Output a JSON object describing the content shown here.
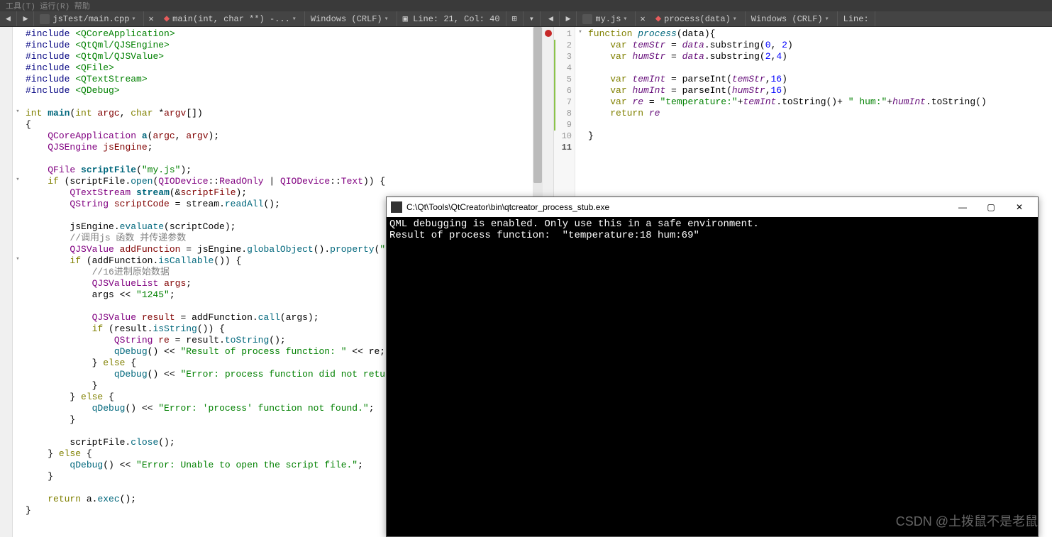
{
  "menu": {
    "text": "工具(T)  运行(R)  帮助"
  },
  "left": {
    "toolbar": {
      "file": "jsTest/main.cpp",
      "symbol": "main(int, char **) -...",
      "encoding": "Windows (CRLF)",
      "position": "Line: 21, Col: 40"
    },
    "code_html": "<span class='pp'>#include</span> <span class='incname'>&lt;QCoreApplication&gt;</span>\n<span class='pp'>#include</span> <span class='incname'>&lt;QtQml/QJSEngine&gt;</span>\n<span class='pp'>#include</span> <span class='incname'>&lt;QtQml/QJSValue&gt;</span>\n<span class='pp'>#include</span> <span class='incname'>&lt;QFile&gt;</span>\n<span class='pp'>#include</span> <span class='incname'>&lt;QTextStream&gt;</span>\n<span class='pp'>#include</span> <span class='incname'>&lt;QDebug&gt;</span>\n\n<span class='kw'>int</span> <span class='fn'>main</span>(<span class='kw'>int</span> <span class='var'>argc</span>, <span class='kw'>char</span> *<span class='var'>argv</span>[])\n{\n    <span class='ty'>QCoreApplication</span> <span class='fn'>a</span>(<span class='var'>argc</span>, <span class='var'>argv</span>);\n    <span class='ty'>QJSEngine</span> <span class='var'>jsEngine</span>;\n\n    <span class='ty'>QFile</span> <span class='fn'>scriptFile</span>(<span class='str'>\"my.js\"</span>);\n    <span class='kw'>if</span> (scriptFile.<span class='fn2'>open</span>(<span class='ty'>QIODevice</span>::<span class='ty'>ReadOnly</span> | <span class='ty'>QIODevice</span>::<span class='ty'>Text</span>)) {\n        <span class='ty'>QTextStream</span> <span class='fn'>stream</span>(&amp;<span class='var'>scriptFile</span>);\n        <span class='ty'>QString</span> <span class='var'>scriptCode</span> = stream.<span class='fn2'>readAll</span>();\n\n        jsEngine.<span class='fn2'>evaluate</span>(scriptCode);\n        <span class='cm'>//调用js 函数 并传递参数</span>\n        <span class='ty'>QJSValue</span> <span class='var'>addFunction</span> = jsEngine.<span class='fn2'>globalObject</span>().<span class='fn2'>property</span>(<span class='str'>\"process\"</span>);\n        <span class='kw'>if</span> (addFunction.<span class='fn2'>isCallable</span>()) {\n            <span class='cm'>//16进制原始数据</span>\n            <span class='ty'>QJSValueList</span> <span class='var'>args</span>;\n            args &lt;&lt; <span class='str'>\"1245\"</span>;\n\n            <span class='ty'>QJSValue</span> <span class='var'>result</span> = addFunction.<span class='fn2'>call</span>(args);\n            <span class='kw'>if</span> (result.<span class='fn2'>isString</span>()) {\n                <span class='ty'>QString</span> <span class='var'>re</span> = result.<span class='fn2'>toString</span>();\n                <span class='fn2'>qDebug</span>() &lt;&lt; <span class='str'>\"Result of process function: \"</span> &lt;&lt; re;\n            } <span class='kw'>else</span> {\n                <span class='fn2'>qDebug</span>() &lt;&lt; <span class='str'>\"Error: process function did not return a valid\"</span>\n            }\n        } <span class='kw'>else</span> {\n            <span class='fn2'>qDebug</span>() &lt;&lt; <span class='str'>\"Error: 'process' function not found.\"</span>;\n        }\n\n        scriptFile.<span class='fn2'>close</span>();\n    } <span class='kw'>else</span> {\n        <span class='fn2'>qDebug</span>() &lt;&lt; <span class='str'>\"Error: Unable to open the script file.\"</span>;\n    }\n\n    <span class='kw'>return</span> a.<span class='fn2'>exec</span>();\n}"
  },
  "right": {
    "toolbar": {
      "file": "my.js",
      "symbol": "process(data)",
      "encoding": "Windows (CRLF)",
      "position": "Line:"
    },
    "line_numbers": [
      "1",
      "2",
      "3",
      "4",
      "5",
      "6",
      "7",
      "8",
      "9",
      "10",
      "11"
    ],
    "code_html": "<span class='js-kw'>function</span> <span class='js-fn'>process</span>(data){\n    <span class='js-kw'>var</span> <span class='js-var'>temStr</span> = <span class='js-var'>data</span>.substring(<span class='js-num'>0</span>, <span class='js-num'>2</span>)\n    <span class='js-kw'>var</span> <span class='js-var'>humStr</span> = <span class='js-var'>data</span>.substring(<span class='js-num'>2</span>,<span class='js-num'>4</span>)\n\n    <span class='js-kw'>var</span> <span class='js-var'>temInt</span> = parseInt(<span class='js-var'>temStr</span>,<span class='js-num'>16</span>)\n    <span class='js-kw'>var</span> <span class='js-var'>humInt</span> = parseInt(<span class='js-var'>humStr</span>,<span class='js-num'>16</span>)\n    <span class='js-kw'>var</span> <span class='js-var'>re</span> = <span class='js-str'>\"temperature:\"</span>+<span class='js-var'>temInt</span>.toString()+ <span class='js-str'>\" hum:\"</span>+<span class='js-var'>humInt</span>.toString()\n    <span class='js-kw'>return</span> <span class='js-var'>re</span>\n\n}\n"
  },
  "console": {
    "title": "C:\\Qt\\Tools\\QtCreator\\bin\\qtcreator_process_stub.exe",
    "line1": "QML debugging is enabled. Only use this in a safe environment.",
    "line2": "Result of process function:  \"temperature:18 hum:69\""
  },
  "watermark": "CSDN @土拨鼠不是老鼠"
}
